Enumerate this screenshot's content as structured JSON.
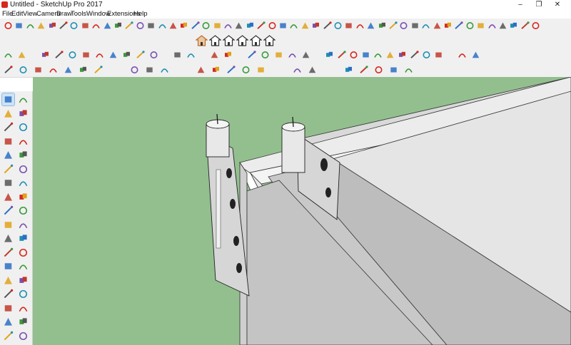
{
  "window": {
    "title": "Untitled - SketchUp Pro 2017"
  },
  "window_controls": {
    "minimize": "–",
    "maximize": "❐",
    "close": "✕"
  },
  "menubar": {
    "items": [
      "File",
      "Edit",
      "View",
      "Camera",
      "Draw",
      "Tools",
      "Window",
      "Extensions",
      "Help"
    ]
  },
  "toolbars": {
    "row1_icons": [
      "orbit-icon",
      "pan-icon",
      "arc-icon",
      "arc2-icon",
      "pie-icon",
      "tape-icon",
      "dimension-icon",
      "protractor-icon",
      "axes-icon",
      "text-icon",
      "3d-text-icon",
      "section-icon",
      "paint-icon",
      "eraser-icon",
      "select-icon",
      "move-icon",
      "rotate-icon",
      "scale-icon",
      "pushpull-icon",
      "followme-icon",
      "offset-icon",
      "zoom-icon",
      "zoom-window-icon",
      "zoom-extents-icon",
      "prev-view-icon",
      "next-view-icon",
      "walk-icon",
      "look-around-icon",
      "position-camera-icon",
      "iso-icon",
      "top-icon",
      "front-icon",
      "right-icon",
      "back-icon",
      "left-icon",
      "bottom-icon",
      "xray-icon",
      "back-edges-icon",
      "wireframe-icon",
      "hidden-line-icon",
      "shaded-icon",
      "textured-icon",
      "monochrome-icon",
      "shadow-icon",
      "fog-icon",
      "layers-icon",
      "components-icon",
      "materials-icon",
      "styles-icon"
    ],
    "views_icons": [
      "iso-view-icon",
      "top-view-icon",
      "front-view-icon",
      "right-view-icon",
      "back-view-icon",
      "left-view-icon"
    ],
    "row2_icons": [
      "select-tool-icon",
      "pencil-icon",
      "lasso-icon",
      "box-icon",
      "sphere-icon",
      "cylinder-icon",
      "cone-icon",
      "torus-icon",
      "tube-icon",
      "prism-icon",
      "link-icon",
      "unlink-icon",
      "sandbox-icon",
      "stamp-icon",
      "drape-icon",
      "flip-icon",
      "sandbox2-icon",
      "shape-icon",
      "shape2-icon",
      "shape3-icon",
      "warehouse-icon",
      "extension-icon",
      "share-icon",
      "share2-icon",
      "model-info-icon",
      "entity-info-icon",
      "outliner-icon",
      "scenes-icon",
      "settings-icon",
      "wrench-icon",
      "gear-icon",
      "help-icon"
    ],
    "row3_icons": [
      "solid-icon",
      "union-icon",
      "subtract-icon",
      "intersect-icon",
      "trim-icon",
      "split-icon",
      "outer-shell-icon",
      "paint-bucket-icon",
      "green-icon",
      "sandbox3-icon",
      "blue-cube-icon",
      "blue-cube2-icon",
      "red-icon",
      "red2-icon",
      "purple-icon",
      "red-pin-icon",
      "pink-icon",
      "blue-box-icon",
      "blue-box2-icon",
      "red-box-icon",
      "red-box2-icon",
      "blue-ring-icon"
    ]
  },
  "left_tools": [
    "select-tool",
    "component-tool",
    "paint-bucket-tool",
    "eraser-tool",
    "line-tool",
    "freehand-tool",
    "rectangle-tool",
    "rotated-rect-tool",
    "circle-tool",
    "polygon-tool",
    "arc-tool",
    "2pt-arc-tool",
    "3pt-arc-tool",
    "pie-tool",
    "move-tool",
    "pushpull-tool",
    "rotate-tool",
    "followme-tool",
    "scale-tool",
    "offset-tool",
    "tape-tool",
    "text-tool",
    "dimension-tool",
    "3dtext-tool",
    "axes-tool",
    "protractor-tool",
    "orbit-tool",
    "pan-tool",
    "zoom-tool",
    "zoom-window-tool",
    "zoom-extents-tool",
    "prev-tool",
    "walk-tool",
    "look-tool",
    "section-tool",
    "position-camera-tool"
  ],
  "colors": {
    "ground": "#93bf8f",
    "sky": "#ffffff",
    "accent": "#d7261e"
  }
}
